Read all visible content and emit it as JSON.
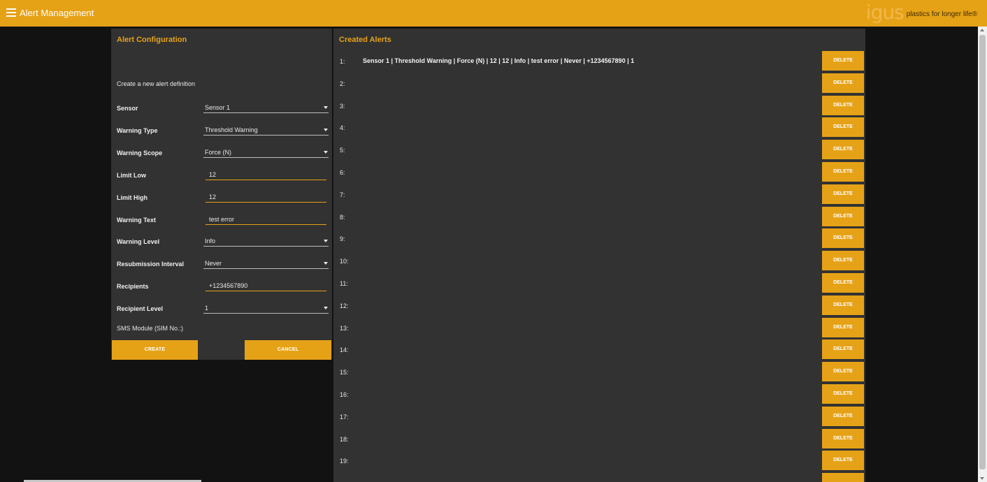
{
  "header": {
    "title": "Alert Management",
    "brand_logo": "igus",
    "brand_slogan": "plastics for longer life®",
    "menu_icon": "hamburger-menu-icon",
    "accent_color": "#e6a217"
  },
  "config": {
    "title": "Alert Configuration",
    "intro": "Create a new alert definition",
    "fields": [
      {
        "label": "Sensor",
        "value": "Sensor 1",
        "type": "select"
      },
      {
        "label": "Warning Type",
        "value": "Threshold Warning",
        "type": "select"
      },
      {
        "label": "Warning Scope",
        "value": "Force (N)",
        "type": "select"
      },
      {
        "label": "Limit Low",
        "value": "12",
        "type": "text"
      },
      {
        "label": "Limit High",
        "value": "12",
        "type": "text"
      },
      {
        "label": "Warning Text",
        "value": "test error",
        "type": "text"
      },
      {
        "label": "Warning Level",
        "value": "Info",
        "type": "select"
      },
      {
        "label": "Resubmission Interval",
        "value": "Never",
        "type": "select"
      },
      {
        "label": "Recipients",
        "value": "+1234567890",
        "type": "text"
      },
      {
        "label": "Recipient Level",
        "value": "1",
        "type": "select"
      }
    ],
    "sms_label": "SMS Module (SIM No.:)",
    "create_label": "CREATE",
    "cancel_label": "CANCEL"
  },
  "alerts": {
    "title": "Created Alerts",
    "delete_label": "DELETE",
    "rows": [
      {
        "num": "1:",
        "text": "Sensor 1 | Threshold Warning | Force (N) | 12 | 12 | Info | test error | Never | +1234567890 | 1"
      },
      {
        "num": "2:",
        "text": ""
      },
      {
        "num": "3:",
        "text": ""
      },
      {
        "num": "4:",
        "text": ""
      },
      {
        "num": "5:",
        "text": ""
      },
      {
        "num": "6:",
        "text": ""
      },
      {
        "num": "7:",
        "text": ""
      },
      {
        "num": "8:",
        "text": ""
      },
      {
        "num": "9:",
        "text": ""
      },
      {
        "num": "10:",
        "text": ""
      },
      {
        "num": "11:",
        "text": ""
      },
      {
        "num": "12:",
        "text": ""
      },
      {
        "num": "13:",
        "text": ""
      },
      {
        "num": "14:",
        "text": ""
      },
      {
        "num": "15:",
        "text": ""
      },
      {
        "num": "16:",
        "text": ""
      },
      {
        "num": "17:",
        "text": ""
      },
      {
        "num": "18:",
        "text": ""
      },
      {
        "num": "19:",
        "text": ""
      }
    ]
  }
}
